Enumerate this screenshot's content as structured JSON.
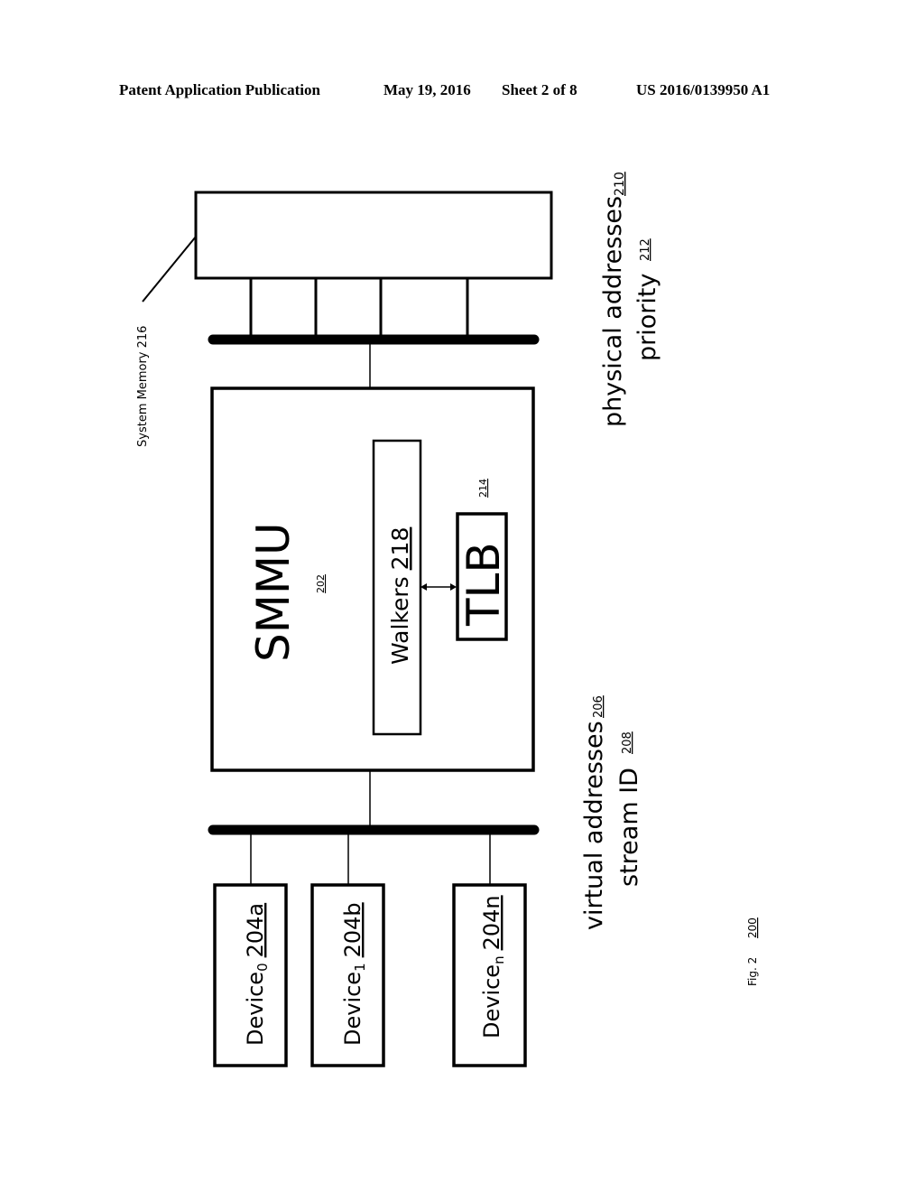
{
  "header": {
    "publication": "Patent Application Publication",
    "date": "May 19, 2016",
    "sheet": "Sheet 2 of 8",
    "number": "US 2016/0139950 A1"
  },
  "figure": {
    "label": "Fig. 2",
    "ref": "200"
  },
  "system_memory": {
    "label": "System Memory 216"
  },
  "smmu": {
    "label": "SMMU",
    "ref": "202",
    "walkers": {
      "label": "Walkers",
      "ref": "218"
    },
    "tlb": {
      "label": "TLB",
      "ref": "214"
    }
  },
  "outputs": {
    "physical_addresses": {
      "label": "physical addresses",
      "ref": "210"
    },
    "priority": {
      "label": "priority",
      "ref": "212"
    }
  },
  "inputs": {
    "virtual_addresses": {
      "label": "virtual addresses",
      "ref": "206"
    },
    "stream_id": {
      "label": "stream ID",
      "ref": "208"
    }
  },
  "devices": [
    {
      "name": "Device",
      "sub": "0",
      "ref": "204a"
    },
    {
      "name": "Device",
      "sub": "1",
      "ref": "204b"
    },
    {
      "name": "Device",
      "sub": "n",
      "ref": "204n"
    }
  ]
}
